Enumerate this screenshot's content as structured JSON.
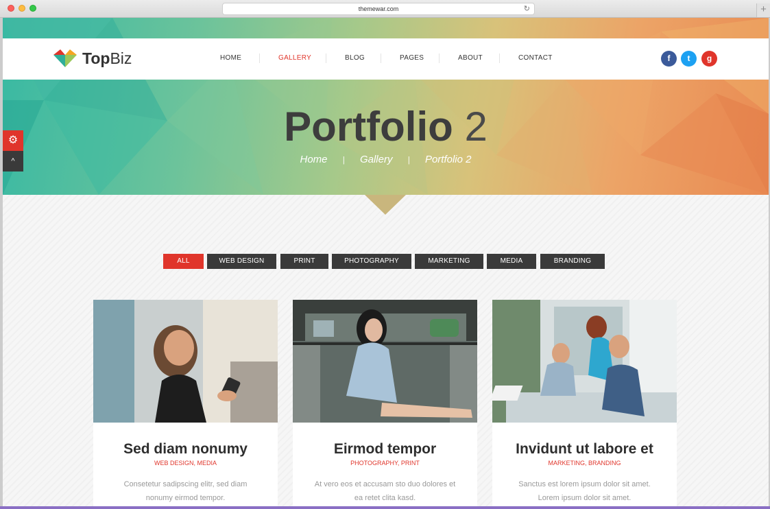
{
  "browser": {
    "url": "themewar.com",
    "reload_icon": "reload-icon",
    "new_tab": "+"
  },
  "site": {
    "logo_bold": "Top",
    "logo_rest": "Biz"
  },
  "nav": {
    "items": [
      "HOME",
      "GALLERY",
      "BLOG",
      "PAGES",
      "ABOUT",
      "CONTACT"
    ],
    "active": "GALLERY",
    "social": [
      {
        "icon": "facebook-icon",
        "glyph": "f"
      },
      {
        "icon": "twitter-icon",
        "glyph": "t"
      },
      {
        "icon": "google-plus-icon",
        "glyph": "g"
      }
    ]
  },
  "hero": {
    "title_bold": "Portfolio",
    "title_light": "2",
    "breadcrumb": [
      "Home",
      "Gallery",
      "Portfolio 2"
    ],
    "breadcrumb_sep": "|"
  },
  "side": {
    "settings_icon": "gear-icon",
    "up_icon": "chevron-up-icon",
    "gear_glyph": "⚙",
    "up_glyph": "^"
  },
  "filters": [
    "ALL",
    "WEB DESIGN",
    "PRINT",
    "PHOTOGRAPHY",
    "MARKETING",
    "MEDIA",
    "BRANDING"
  ],
  "active_filter": "ALL",
  "portfolio": [
    {
      "title": "Sed diam nonumy",
      "categories": "WEB DESIGN, MEDIA",
      "desc": "Consetetur sadipscing elitr, sed diam nonumy eirmod tempor."
    },
    {
      "title": "Eirmod tempor",
      "categories": "PHOTOGRAPHY, PRINT",
      "desc": "At vero eos et accusam sto duo dolores et ea retet clita kasd."
    },
    {
      "title": "Invidunt ut labore et",
      "categories": "MARKETING, BRANDING",
      "desc": "Sanctus est lorem ipsum dolor sit amet. Lorem ipsum dolor sit amet."
    }
  ],
  "colors": {
    "accent": "#e0352b",
    "dark": "#3a3a3a",
    "facebook": "#3b5a9a",
    "twitter": "#1da1f2"
  }
}
